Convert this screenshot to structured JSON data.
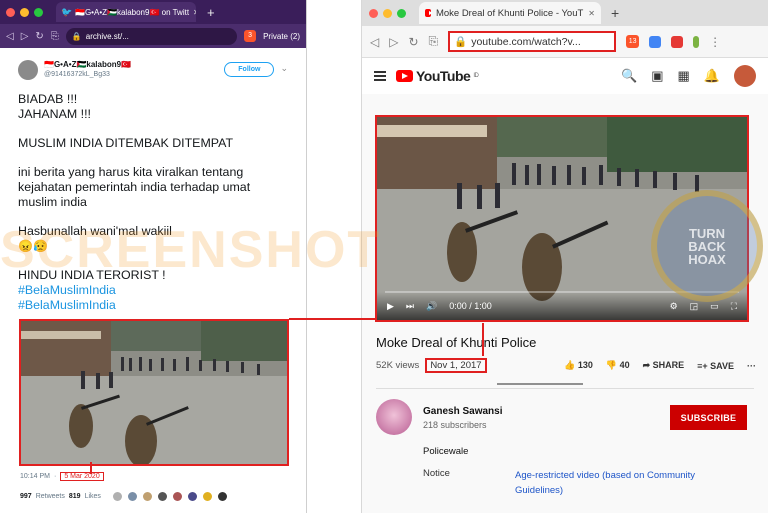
{
  "left_window": {
    "tab_title": "🇮🇩G•A•Z🇵🇸kalabon9🇹🇷 on Twitt",
    "url": "archive.st/...",
    "private_label": "Private (2)",
    "brave_count": "3",
    "tweet": {
      "display_name": "🇮🇩G•A•Z🇵🇸kalabon9🇹🇷",
      "handle": "@91416372kL_Bg33",
      "follow_label": "Follow",
      "lines": [
        "BIADAB !!!",
        "JAHANAM !!!",
        "",
        "MUSLIM INDIA DITEMBAK DITEMPAT",
        "",
        "ini berita yang harus kita viralkan tentang",
        "kejahatan pemerintah india terhadap umat",
        "muslim india",
        "",
        "Hasbunallah wani'mal wakiil",
        "😠😥",
        "",
        "HINDU INDIA TERORIST !"
      ],
      "hashtags": [
        "#BelaMuslimIndia",
        "#BelaMuslimIndia"
      ],
      "time": "10:14 PM",
      "date": "5 Mar 2020",
      "retweets_count": "997",
      "retweets_label": "Retweets",
      "likes_count": "819",
      "likes_label": "Likes"
    }
  },
  "right_window": {
    "tab_title": "Moke Dreal of Khunti Police - YouT",
    "url": "youtube.com/watch?v...",
    "brave_count": "13",
    "logo_text": "YouTube",
    "logo_region": "ID",
    "player": {
      "time": "0:00 / 1:00"
    },
    "video": {
      "title": "Moke Dreal of Khunti Police",
      "views": "52K views",
      "date": "Nov 1, 2017",
      "likes": "130",
      "dislikes": "40",
      "share_label": "SHARE",
      "save_label": "SAVE"
    },
    "channel": {
      "name": "Ganesh Sawansi",
      "subscribers": "218 subscribers",
      "subscribe_label": "SUBSCRIBE"
    },
    "description": {
      "line1": "Policewale",
      "notice_label": "Notice",
      "notice_value": "Age-restricted video (based on Community Guidelines)"
    }
  },
  "watermark": {
    "text": "SCREENSHOT",
    "badge_lines": [
      "TURN",
      "BACK",
      "HOAX"
    ]
  },
  "colors": {
    "highlight": "#e02020",
    "yt_red": "#ff0000",
    "twitter_blue": "#1da1f2",
    "brave_orange": "#fb542b"
  }
}
